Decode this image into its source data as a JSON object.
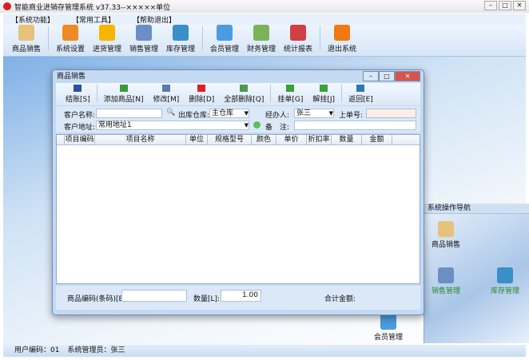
{
  "window": {
    "title": "智能商业进销存管理系统 v37.33--×××××单位"
  },
  "menu": [
    "【系统功能】",
    "【常用工具】",
    "【帮助退出】"
  ],
  "toolbar": [
    {
      "label": "商品销售",
      "color": "#e6c27a"
    },
    {
      "label": "系统设置",
      "color": "#f08a24"
    },
    {
      "label": "进货管理",
      "color": "#f7b500"
    },
    {
      "label": "销售管理",
      "color": "#6b8fc4"
    },
    {
      "label": "库存管理",
      "color": "#3a8fc8"
    },
    {
      "label": "会员管理",
      "color": "#4a9be0"
    },
    {
      "label": "财务管理",
      "color": "#7bb35a"
    },
    {
      "label": "统计报表",
      "color": "#d04040"
    },
    {
      "label": "退出系统",
      "color": "#f07a10"
    }
  ],
  "dialog": {
    "title": "商品销售",
    "tools": [
      {
        "label": "结账[S]",
        "color": "#2a4fa8"
      },
      {
        "label": "添加商品[N]",
        "color": "#3a9a3a"
      },
      {
        "label": "修改[M]",
        "color": "#5a7ab0"
      },
      {
        "label": "删除[D]",
        "color": "#e02020"
      },
      {
        "label": "全部删除[Q]",
        "color": "#4a9a4a"
      },
      {
        "label": "挂单[G]",
        "color": "#3aa03a"
      },
      {
        "label": "解挂[J]",
        "color": "#3aa03a"
      },
      {
        "label": "返回[E]",
        "color": "#2a7ab0"
      }
    ],
    "form": {
      "customer_label": "客户名称:",
      "customer_value": "",
      "warehouse_label": "出库仓库:",
      "warehouse_value": "主仓库",
      "handler_label": "经办人:",
      "handler_value": "张三",
      "prev_label": "上单号:",
      "prev_value": "",
      "address_label": "客户地址:",
      "address_value": "常用地址1",
      "note_label": "备　注:",
      "note_value": ""
    },
    "columns": [
      "项目编码",
      "项目名称",
      "单位",
      "规格型号",
      "颜色",
      "单价",
      "折扣率",
      "数量",
      "金额"
    ],
    "rows": [],
    "bottom": {
      "barcode_label": "商品编码(条码)[B]:",
      "barcode_value": "",
      "qty_label": "数量[L]:",
      "qty_value": "1.00",
      "total_label": "合计金额:"
    }
  },
  "nav": {
    "title": "系统操作导航",
    "items": [
      "商品销售",
      "销售管理",
      "库存管理",
      "会员管理"
    ]
  },
  "status": {
    "user_code": "用户编码：01",
    "admin": "系统管理员：张三"
  }
}
